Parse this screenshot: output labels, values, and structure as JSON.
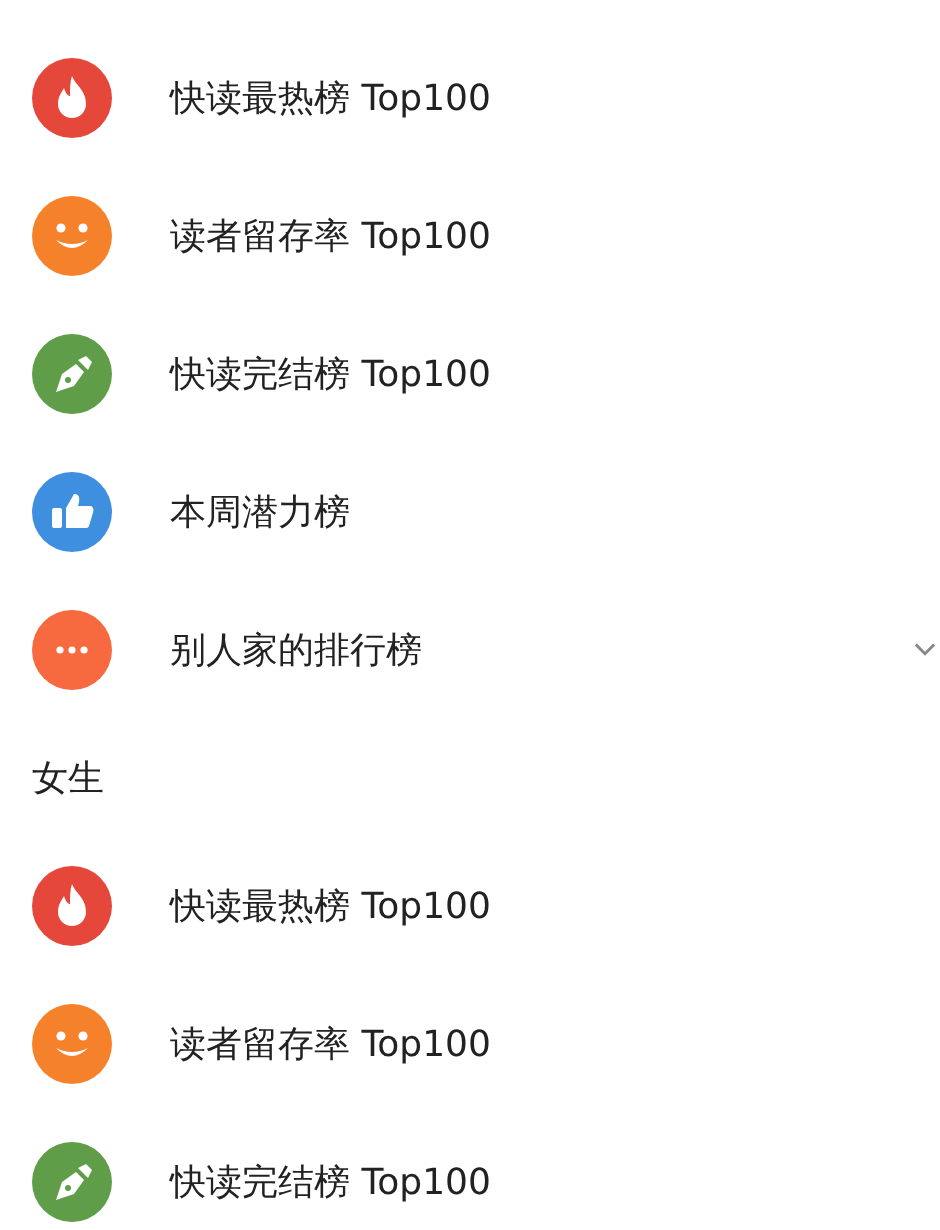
{
  "sections": [
    {
      "items": [
        {
          "kind": "flame",
          "color": "#e5483b",
          "label": "快读最热榜 Top100"
        },
        {
          "kind": "smile",
          "color": "#f5822a",
          "label": "读者留存率 Top100"
        },
        {
          "kind": "pen",
          "color": "#5f9d48",
          "label": "快读完结榜 Top100"
        },
        {
          "kind": "thumb",
          "color": "#3f8fe0",
          "label": "本周潜力榜"
        },
        {
          "kind": "more",
          "color": "#f7693f",
          "label": "别人家的排行榜",
          "expanded": false
        }
      ]
    },
    {
      "title": "女生",
      "items": [
        {
          "kind": "flame",
          "color": "#e5483b",
          "label": "快读最热榜 Top100"
        },
        {
          "kind": "smile",
          "color": "#f5822a",
          "label": "读者留存率 Top100"
        },
        {
          "kind": "pen",
          "color": "#5f9d48",
          "label": "快读完结榜 Top100"
        }
      ]
    }
  ]
}
